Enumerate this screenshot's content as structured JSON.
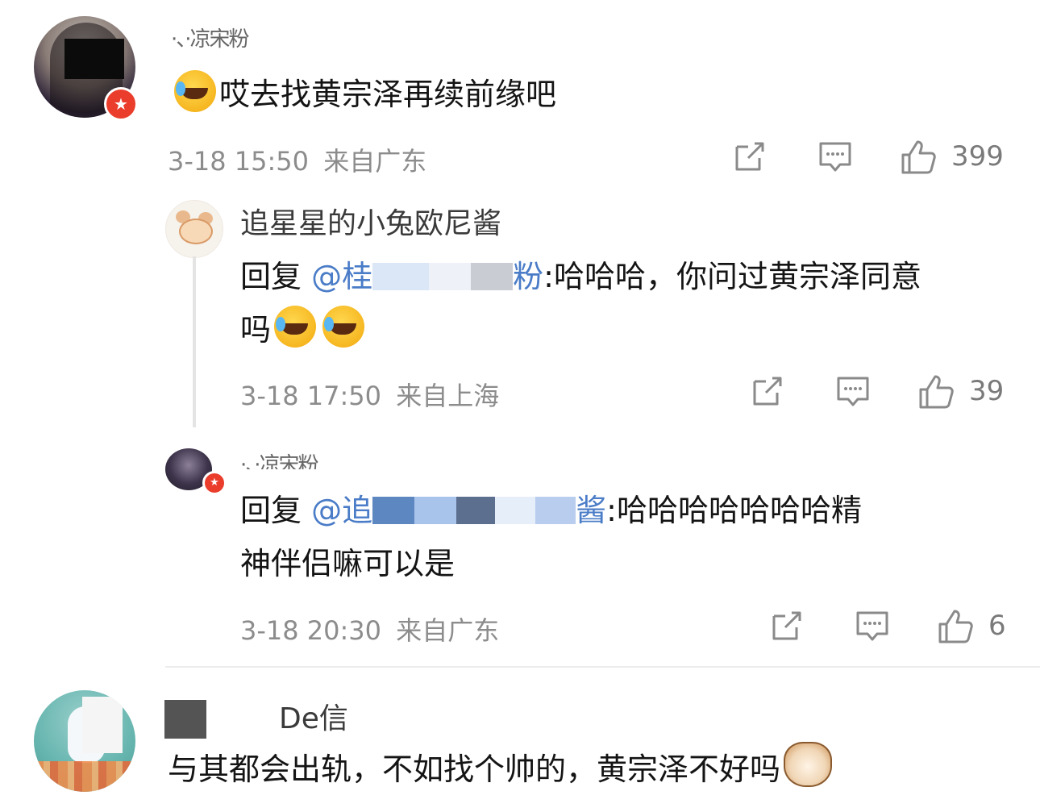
{
  "comments": [
    {
      "username": "·、·凉宋粉",
      "text": "哎去找黄宗泽再续前缘吧",
      "time": "3-18 15:50",
      "location": "来自广东",
      "likes": "399",
      "replies": [
        {
          "username": "追星星的小兔欧尼酱",
          "reply_prefix": "回复",
          "mention_visible_start": "@桂",
          "mention_visible_end": "粉",
          "text": ":哈哈哈，你问过黄宗泽同意",
          "text_line2": "吗",
          "time": "3-18 17:50",
          "location": "来自上海",
          "likes": "39"
        },
        {
          "username": "·、·凉宋粉",
          "reply_prefix": "回复",
          "mention_visible_start": "@追",
          "mention_visible_end": "酱",
          "text": ":哈哈哈哈哈哈哈精",
          "text_line2": "神伴侣嘛可以是",
          "time": "3-18 20:30",
          "location": "来自广东",
          "likes": "6"
        }
      ]
    },
    {
      "username": "De信",
      "text": "与其都会出轨，不如找个帅的，黄宗泽不好吗"
    }
  ],
  "icons": {
    "share": "share-icon",
    "comment": "comment-icon",
    "like": "thumbs-up-icon",
    "emoji_cry_laugh": "cry-laugh-emoji",
    "emoji_cat": "cat-emoji",
    "vip_badge": "star-badge-icon"
  },
  "colors": {
    "mention": "#4a7cc7",
    "meta": "#8c8c8c",
    "badge": "#ea3d2c"
  }
}
